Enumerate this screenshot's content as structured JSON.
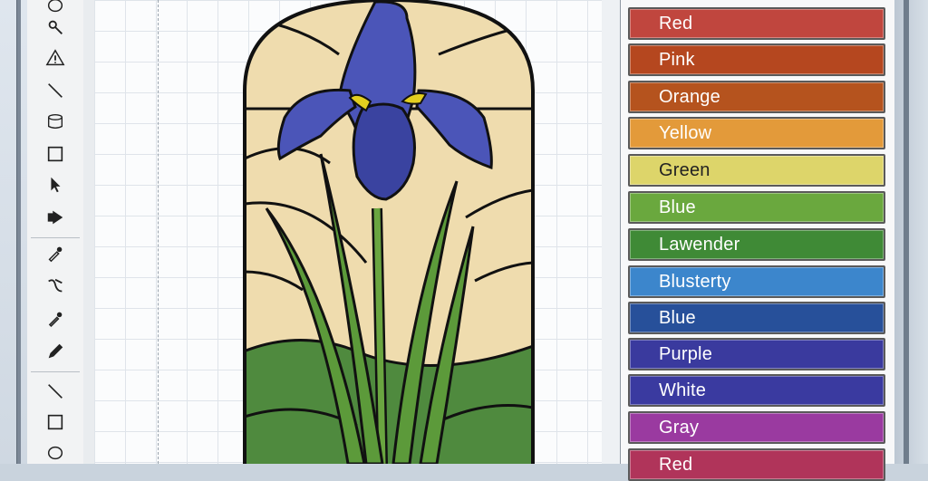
{
  "toolbar": {
    "tools": [
      {
        "name": "ellipse-tool",
        "icon": "ellipse-icon"
      },
      {
        "name": "pen-tool",
        "icon": "pen-icon"
      },
      {
        "name": "warning-tool",
        "icon": "triangle-warning-icon"
      },
      {
        "name": "line-tool",
        "icon": "line-icon"
      },
      {
        "name": "shape-tool",
        "icon": "cylinder-icon"
      },
      {
        "name": "rectangle-tool",
        "icon": "rectangle-icon"
      },
      {
        "name": "select-tool",
        "icon": "arrow-cursor-icon"
      },
      {
        "name": "fill-tool",
        "icon": "fill-arrow-icon"
      },
      {
        "name": "eyedropper-tool",
        "icon": "eyedropper-icon"
      },
      {
        "name": "path-tool",
        "icon": "path-icon"
      },
      {
        "name": "dropper-tool",
        "icon": "dropper-icon"
      },
      {
        "name": "pencil-tool",
        "icon": "pencil-icon"
      },
      {
        "name": "line-tool-2",
        "icon": "line-icon"
      },
      {
        "name": "rectangle-tool-2",
        "icon": "rectangle-icon"
      },
      {
        "name": "ellipse-tool-2",
        "icon": "ellipse-icon"
      }
    ]
  },
  "palette": {
    "colors": [
      {
        "label": "Red",
        "color": "#c0463e"
      },
      {
        "label": "Pink",
        "color": "#b5471f"
      },
      {
        "label": "Orange",
        "color": "#b5531e"
      },
      {
        "label": "Yellow",
        "color": "#e39a3a",
        "dark": false
      },
      {
        "label": "Green",
        "color": "#ddd56a",
        "dark": true
      },
      {
        "label": "Blue",
        "color": "#6aa83e"
      },
      {
        "label": "Lawender",
        "color": "#3f8a36"
      },
      {
        "label": "Blusterty",
        "color": "#3c86cc"
      },
      {
        "label": "Blue",
        "color": "#27509a"
      },
      {
        "label": "Purple",
        "color": "#3a3a9e"
      },
      {
        "label": "White",
        "color": "#3a3aa0"
      },
      {
        "label": "Gray",
        "color": "#9a3aa0"
      },
      {
        "label": "Red",
        "color": "#b0345a"
      }
    ]
  },
  "artwork": {
    "colors": {
      "sky": "#efdcae",
      "petal": "#4b55b8",
      "petal_dark": "#3a43a0",
      "yellow": "#e3cf1f",
      "leaf": "#5c9a3a",
      "ground": "#4f8a3e",
      "lead": "#111111"
    }
  }
}
